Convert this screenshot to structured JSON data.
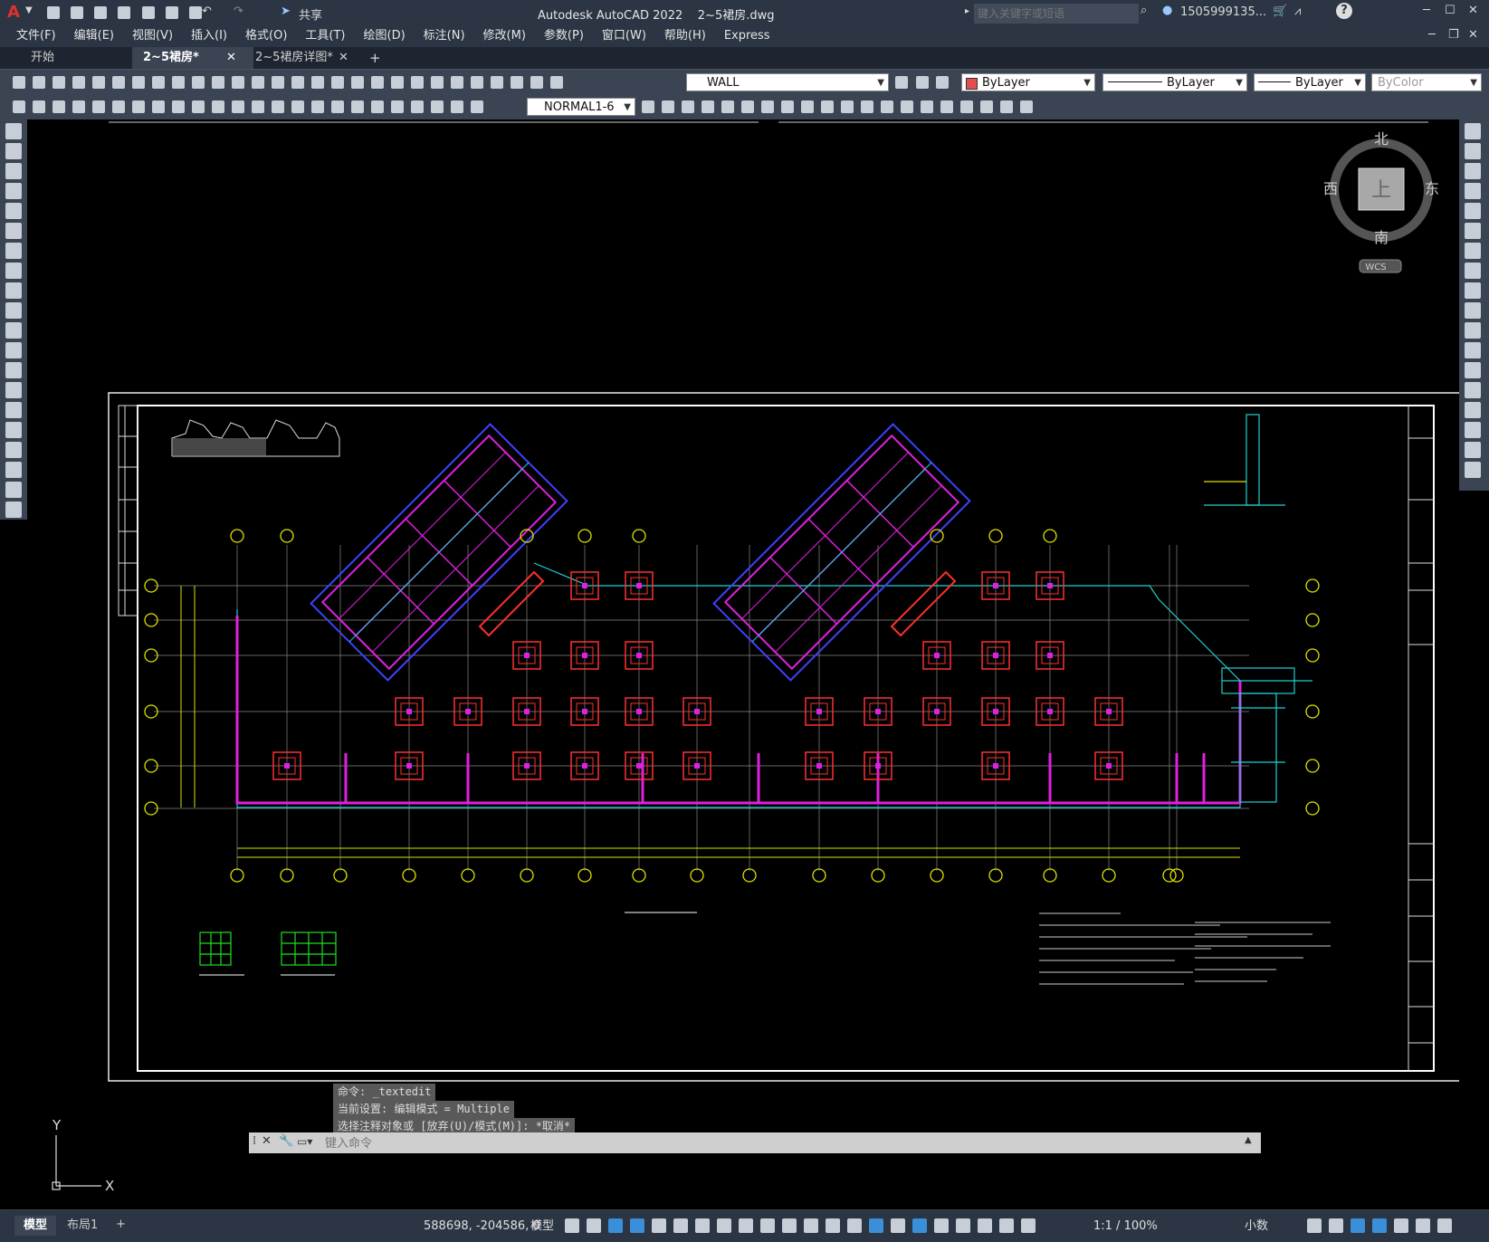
{
  "app": {
    "title": "Autodesk AutoCAD 2022",
    "filename": "2~5裙房.dwg",
    "share_label": "共享",
    "search_placeholder": "键入关键字或短语",
    "user": "1505999135...",
    "logo_letter": "A"
  },
  "menu": [
    "文件(F)",
    "编辑(E)",
    "视图(V)",
    "插入(I)",
    "格式(O)",
    "工具(T)",
    "绘图(D)",
    "标注(N)",
    "修改(M)",
    "参数(P)",
    "窗口(W)",
    "帮助(H)",
    "Express"
  ],
  "tabs": [
    {
      "label": "开始",
      "active": false
    },
    {
      "label": "2~5裙房*",
      "active": true
    },
    {
      "label": "2~5裙房详图*",
      "active": false
    }
  ],
  "toolbar": {
    "layer": "WALL",
    "color": "ByLayer",
    "linetype": "ByLayer",
    "lineweight": "ByLayer",
    "plotstyle": "ByColor",
    "dimstyle": "NORMAL1-6",
    "layer_color": "#e05050"
  },
  "viewcube": {
    "north": "北",
    "south": "南",
    "east": "东",
    "west": "西",
    "face": "上",
    "wcs": "WCS"
  },
  "ucs": {
    "y": "Y",
    "x": "X"
  },
  "command": {
    "history": [
      "命令: _textedit",
      "当前设置: 编辑模式 = Multiple",
      "选择注释对象或 [放弃(U)/模式(M)]: *取消*"
    ],
    "placeholder": "键入命令"
  },
  "status": {
    "model_tab": "模型",
    "layout_tab": "布局1",
    "coords": "588698, -204586, 0",
    "space": "模型",
    "scale": "1:1 / 100%",
    "units": "小数"
  }
}
